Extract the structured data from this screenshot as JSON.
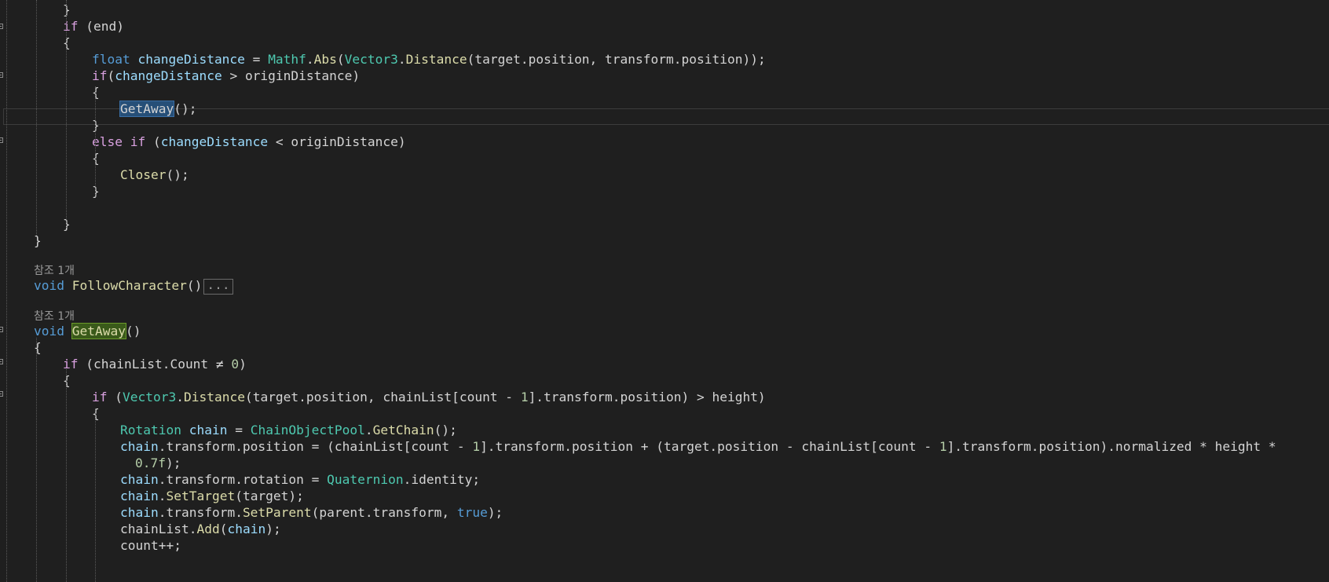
{
  "colors": {
    "background": "#1f1f1f",
    "keyword": "#569cd6",
    "control": "#d8a0df",
    "type": "#4ec9b0",
    "method": "#dcdcaa",
    "variable": "#9cdcfe",
    "number": "#b5cea8"
  },
  "editor": {
    "code_lines": [
      [
        [
          "pl",
          "}"
        ]
      ],
      [
        [
          "ctl",
          "if"
        ],
        [
          "pl",
          " (end)"
        ]
      ],
      [
        [
          "pl",
          "{"
        ]
      ],
      [
        [
          "kw",
          "float"
        ],
        [
          "pl",
          " "
        ],
        [
          "var",
          "changeDistance"
        ],
        [
          "pl",
          " = "
        ],
        [
          "ty",
          "Mathf"
        ],
        [
          "pl",
          "."
        ],
        [
          "fn",
          "Abs"
        ],
        [
          "pl",
          "("
        ],
        [
          "ty",
          "Vector3"
        ],
        [
          "pl",
          "."
        ],
        [
          "fn",
          "Distance"
        ],
        [
          "pl",
          "(target.position, transform.position));"
        ]
      ],
      [
        [
          "ctl",
          "if"
        ],
        [
          "pl",
          "("
        ],
        [
          "var",
          "changeDistance"
        ],
        [
          "pl",
          " > originDistance)"
        ]
      ],
      [
        [
          "pl",
          "{"
        ]
      ],
      [
        [
          "hl-sel",
          "GetAway"
        ],
        [
          "pl",
          "();"
        ]
      ],
      [
        [
          "pl",
          "}"
        ]
      ],
      [
        [
          "ctl",
          "else if"
        ],
        [
          "pl",
          " ("
        ],
        [
          "var",
          "changeDistance"
        ],
        [
          "pl",
          " < originDistance)"
        ]
      ],
      [
        [
          "pl",
          "{"
        ]
      ],
      [
        [
          "fn",
          "Closer"
        ],
        [
          "pl",
          "();"
        ]
      ],
      [
        [
          "pl",
          "}"
        ]
      ],
      [
        [
          "pl",
          ""
        ]
      ],
      [
        [
          "pl",
          "}"
        ]
      ],
      [
        [
          "pl",
          "}"
        ]
      ],
      [
        [
          "refhint",
          "참조 1개"
        ]
      ],
      [
        [
          "kw",
          "void"
        ],
        [
          "pl",
          " "
        ],
        [
          "fn",
          "FollowCharacter"
        ],
        [
          "pl",
          "()"
        ],
        [
          "collapsed",
          "..."
        ]
      ],
      [
        [
          "refhint",
          "참조 1개"
        ]
      ],
      [
        [
          "kw",
          "void"
        ],
        [
          "pl",
          " "
        ],
        [
          "hl-def",
          "GetAway"
        ],
        [
          "pl",
          "()"
        ]
      ],
      [
        [
          "pl",
          "{"
        ]
      ],
      [
        [
          "ctl",
          "if"
        ],
        [
          "pl",
          " (chainList.Count ≠ "
        ],
        [
          "num",
          "0"
        ],
        [
          "pl",
          ")"
        ]
      ],
      [
        [
          "pl",
          "{"
        ]
      ],
      [
        [
          "ctl",
          "if"
        ],
        [
          "pl",
          " ("
        ],
        [
          "ty",
          "Vector3"
        ],
        [
          "pl",
          "."
        ],
        [
          "fn",
          "Distance"
        ],
        [
          "pl",
          "(target.position, chainList[count - "
        ],
        [
          "num",
          "1"
        ],
        [
          "pl",
          "].transform.position) > height)"
        ]
      ],
      [
        [
          "pl",
          "{"
        ]
      ],
      [
        [
          "ty",
          "Rotation"
        ],
        [
          "pl",
          " "
        ],
        [
          "var",
          "chain"
        ],
        [
          "pl",
          " = "
        ],
        [
          "ty",
          "ChainObjectPool"
        ],
        [
          "pl",
          "."
        ],
        [
          "fn",
          "GetChain"
        ],
        [
          "pl",
          "();"
        ]
      ],
      [
        [
          "var",
          "chain"
        ],
        [
          "pl",
          ".transform.position = (chainList[count - "
        ],
        [
          "num",
          "1"
        ],
        [
          "pl",
          "].transform.position + (target.position - chainList[count - "
        ],
        [
          "num",
          "1"
        ],
        [
          "pl",
          "].transform.position).normalized * height * "
        ]
      ],
      [
        [
          "num",
          "0.7f"
        ],
        [
          "pl",
          ");"
        ]
      ],
      [
        [
          "var",
          "chain"
        ],
        [
          "pl",
          ".transform.rotation = "
        ],
        [
          "ty",
          "Quaternion"
        ],
        [
          "pl",
          ".identity;"
        ]
      ],
      [
        [
          "var",
          "chain"
        ],
        [
          "pl",
          "."
        ],
        [
          "fn",
          "SetTarget"
        ],
        [
          "pl",
          "(target);"
        ]
      ],
      [
        [
          "var",
          "chain"
        ],
        [
          "pl",
          ".transform."
        ],
        [
          "fn",
          "SetParent"
        ],
        [
          "pl",
          "(parent.transform, "
        ],
        [
          "kw",
          "true"
        ],
        [
          "pl",
          ");"
        ]
      ],
      [
        [
          "pl",
          "chainList."
        ],
        [
          "fn",
          "Add"
        ],
        [
          "pl",
          "("
        ],
        [
          "var",
          "chain"
        ],
        [
          "pl",
          ");"
        ]
      ],
      [
        [
          "pl",
          "count++;"
        ]
      ]
    ]
  }
}
